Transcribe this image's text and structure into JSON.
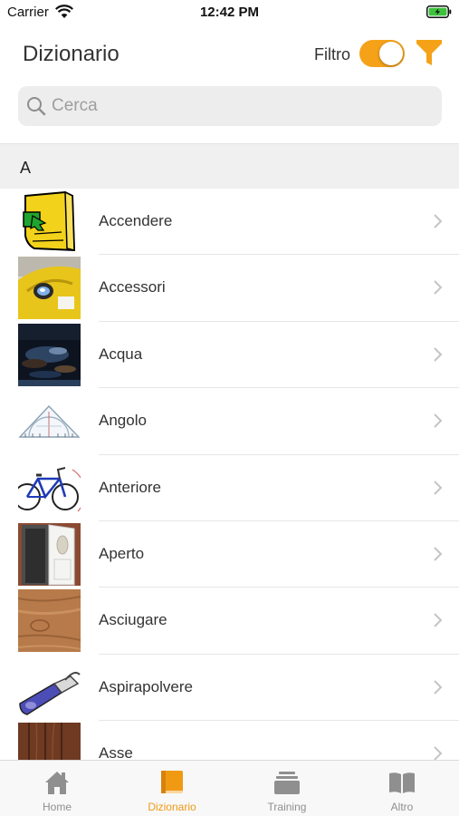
{
  "status_bar": {
    "carrier": "Carrier",
    "time": "12:42 PM"
  },
  "header": {
    "title": "Dizionario",
    "filter_label": "Filtro",
    "filter_enabled": true
  },
  "search": {
    "placeholder": "Cerca",
    "value": ""
  },
  "section": {
    "letter": "A"
  },
  "items": [
    {
      "label": "Accendere",
      "icon": "yellow-switch-thumb"
    },
    {
      "label": "Accessori",
      "icon": "yellow-helmet-light-thumb"
    },
    {
      "label": "Acqua",
      "icon": "dark-water-thumb"
    },
    {
      "label": "Angolo",
      "icon": "protractor-thumb"
    },
    {
      "label": "Anteriore",
      "icon": "bicycle-thumb"
    },
    {
      "label": "Aperto",
      "icon": "open-door-thumb"
    },
    {
      "label": "Asciugare",
      "icon": "wood-texture-thumb"
    },
    {
      "label": "Aspirapolvere",
      "icon": "handheld-vacuum-thumb"
    },
    {
      "label": "Asse",
      "icon": "wood-plank-thumb"
    }
  ],
  "tabs": [
    {
      "label": "Home",
      "icon": "home-icon",
      "active": false
    },
    {
      "label": "Dizionario",
      "icon": "book-icon",
      "active": true
    },
    {
      "label": "Training",
      "icon": "stack-icon",
      "active": false
    },
    {
      "label": "Altro",
      "icon": "open-book-icon",
      "active": false
    }
  ],
  "colors": {
    "accent": "#f5a219",
    "active_tab": "#f09a14",
    "inactive_tab": "#8f8f8f"
  }
}
